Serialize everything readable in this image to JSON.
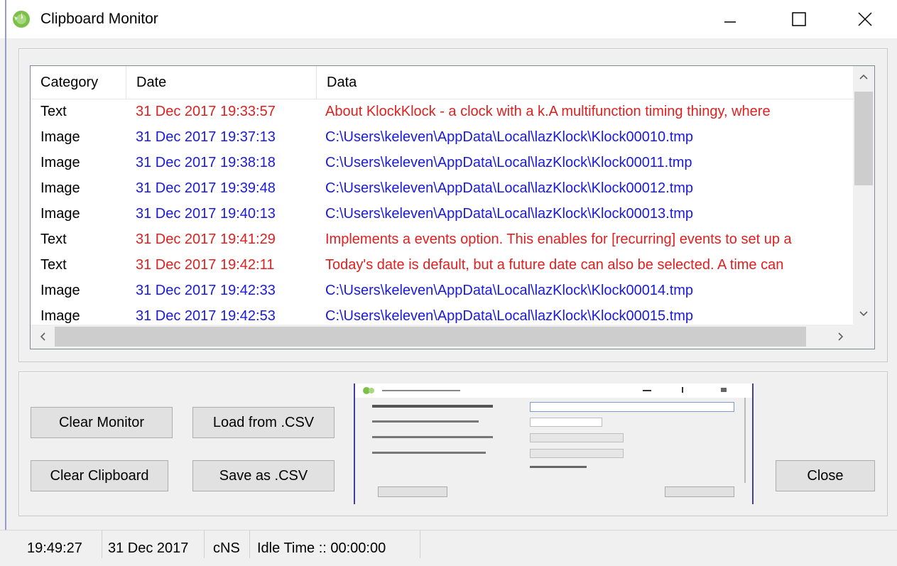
{
  "window": {
    "title": "Clipboard Monitor"
  },
  "colors": {
    "text_entry": "#e02020",
    "image_entry": "#1a1adc"
  },
  "list": {
    "columns": [
      "Category",
      "Date",
      "Data"
    ],
    "rows": [
      {
        "category": "Text",
        "date": "31 Dec 2017 19:33:57",
        "data": "About KlockKlock - a clock with a k.A multifunction timing thingy, where",
        "kind": "text"
      },
      {
        "category": "Image",
        "date": "31 Dec 2017 19:37:13",
        "data": "C:\\Users\\keleven\\AppData\\Local\\lazKlock\\Klock00010.tmp",
        "kind": "image"
      },
      {
        "category": "Image",
        "date": "31 Dec 2017 19:38:18",
        "data": "C:\\Users\\keleven\\AppData\\Local\\lazKlock\\Klock00011.tmp",
        "kind": "image"
      },
      {
        "category": "Image",
        "date": "31 Dec 2017 19:39:48",
        "data": "C:\\Users\\keleven\\AppData\\Local\\lazKlock\\Klock00012.tmp",
        "kind": "image"
      },
      {
        "category": "Image",
        "date": "31 Dec 2017 19:40:13",
        "data": "C:\\Users\\keleven\\AppData\\Local\\lazKlock\\Klock00013.tmp",
        "kind": "image"
      },
      {
        "category": "Text",
        "date": "31 Dec 2017 19:41:29",
        "data": "Implements a events option. This enables for [recurring] events to set up a",
        "kind": "text"
      },
      {
        "category": "Text",
        "date": "31 Dec 2017 19:42:11",
        "data": "Today's date is default, but a future date can also be selected.  A time can",
        "kind": "text"
      },
      {
        "category": "Image",
        "date": "31 Dec 2017 19:42:33",
        "data": "C:\\Users\\keleven\\AppData\\Local\\lazKlock\\Klock00014.tmp",
        "kind": "image"
      },
      {
        "category": "Image",
        "date": "31 Dec 2017 19:42:53",
        "data": "C:\\Users\\keleven\\AppData\\Local\\lazKlock\\Klock00015.tmp",
        "kind": "image"
      }
    ]
  },
  "buttons": {
    "clear_monitor": "Clear Monitor",
    "load_csv": "Load from .CSV",
    "clear_clipboard": "Clear Clipboard",
    "save_csv": "Save as .CSV",
    "close": "Close"
  },
  "status": {
    "time": "19:49:27",
    "date": "31 Dec 2017",
    "mode": "cNS",
    "idle": "Idle Time :: 00:00:00"
  }
}
